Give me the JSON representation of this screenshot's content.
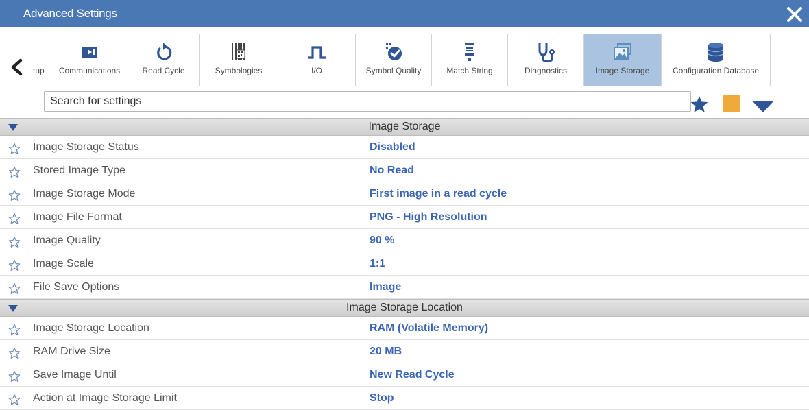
{
  "window": {
    "title": "Advanced Settings"
  },
  "colors": {
    "title_bar": "#4a78b5",
    "active_tab": "#a9c3e1",
    "value_text": "#3b66b3",
    "accent_square": "#f0a93b",
    "favorite_star": "#2f5596"
  },
  "tabs": [
    {
      "label": "tup",
      "icon": "setup-icon",
      "active": false
    },
    {
      "label": "Communications",
      "icon": "communications-icon",
      "active": false
    },
    {
      "label": "Read Cycle",
      "icon": "refresh-icon",
      "active": false
    },
    {
      "label": "Symbologies",
      "icon": "barcode-icon",
      "active": false
    },
    {
      "label": "I/O",
      "icon": "pulse-icon",
      "active": false
    },
    {
      "label": "Symbol Quality",
      "icon": "quality-badge-icon",
      "active": false
    },
    {
      "label": "Match String",
      "icon": "match-string-icon",
      "active": false
    },
    {
      "label": "Diagnostics",
      "icon": "stethoscope-icon",
      "active": false
    },
    {
      "label": "Image Storage",
      "icon": "image-icon",
      "active": true
    },
    {
      "label": "Configuration Database",
      "icon": "database-icon",
      "active": false
    }
  ],
  "search": {
    "placeholder": "Search for settings"
  },
  "sections": [
    {
      "title": "Image Storage",
      "rows": [
        {
          "label": "Image Storage Status",
          "value": "Disabled"
        },
        {
          "label": "Stored Image Type",
          "value": "No Read"
        },
        {
          "label": "Image Storage Mode",
          "value": "First image in a read cycle"
        },
        {
          "label": "Image File Format",
          "value": "PNG - High Resolution"
        },
        {
          "label": "Image Quality",
          "value": "90 %"
        },
        {
          "label": "Image Scale",
          "value": "1:1"
        },
        {
          "label": "File Save Options",
          "value": "Image"
        }
      ]
    },
    {
      "title": "Image Storage Location",
      "rows": [
        {
          "label": "Image Storage Location",
          "value": "RAM (Volatile Memory)"
        },
        {
          "label": "RAM Drive Size",
          "value": "20 MB"
        },
        {
          "label": "Save Image Until",
          "value": "New Read Cycle"
        },
        {
          "label": "Action at Image Storage Limit",
          "value": "Stop"
        }
      ]
    }
  ]
}
